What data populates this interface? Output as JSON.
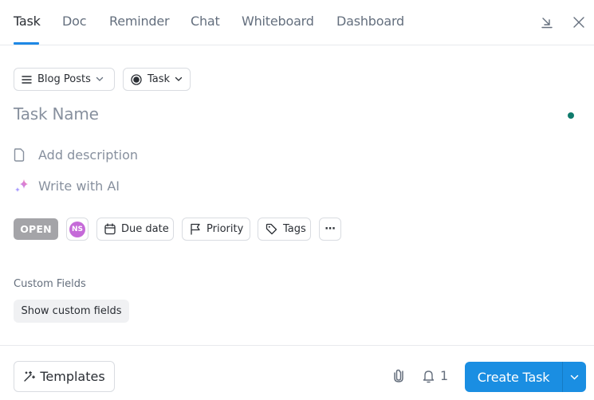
{
  "tabs": [
    {
      "label": "Task",
      "active": true
    },
    {
      "label": "Doc",
      "active": false
    },
    {
      "label": "Reminder",
      "active": false
    },
    {
      "label": "Chat",
      "active": false
    },
    {
      "label": "Whiteboard",
      "active": false
    },
    {
      "label": "Dashboard",
      "active": false
    }
  ],
  "header_icons": {
    "minimize": "minimize-arrow-icon",
    "close": "close-icon"
  },
  "selectors": {
    "list": {
      "label": "Blog Posts",
      "icon": "list-icon"
    },
    "type": {
      "label": "Task",
      "icon": "radio-circle-icon"
    }
  },
  "task_name": {
    "placeholder": "Task Name"
  },
  "status_dot_color": "#0f7b6c",
  "description": {
    "label": "Add description",
    "icon": "document-icon"
  },
  "ai": {
    "label": "Write with AI",
    "icon": "sparkle-icon"
  },
  "properties": {
    "status": "OPEN",
    "status_color": "#a4a4a8",
    "assignee_initials": "NS",
    "assignee_color": "#c56ad8",
    "due_date": "Due date",
    "priority": "Priority",
    "tags": "Tags",
    "more": "⋯"
  },
  "custom_fields": {
    "label": "Custom Fields",
    "button": "Show custom fields"
  },
  "footer": {
    "templates": "Templates",
    "notification_count": "1",
    "create": "Create Task",
    "accent": "#1a8ee2"
  }
}
